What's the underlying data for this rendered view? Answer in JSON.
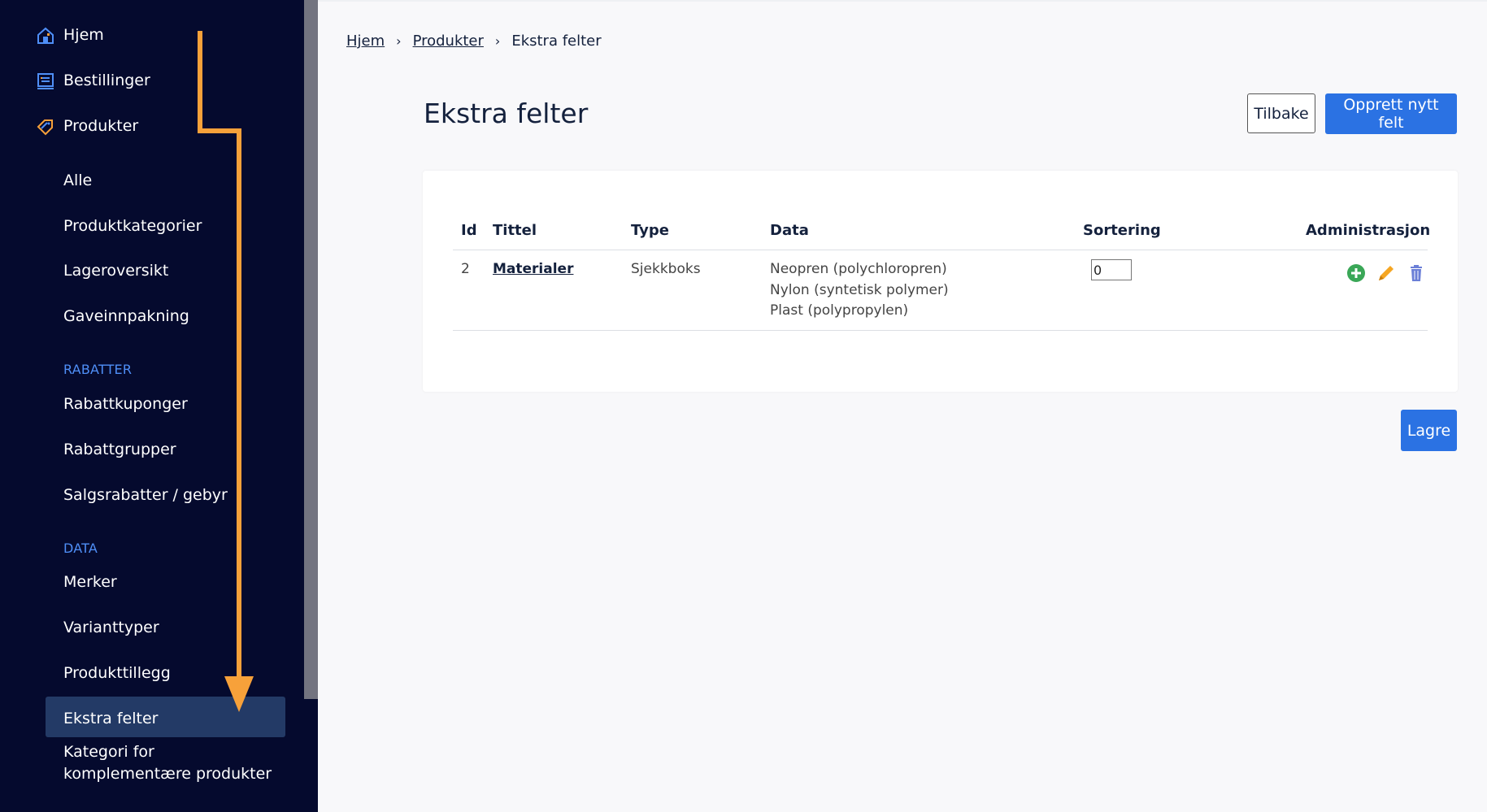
{
  "sidebar": {
    "top_items": [
      {
        "label": "Hjem",
        "icon": "house-icon"
      },
      {
        "label": "Bestillinger",
        "icon": "orders-list-icon"
      },
      {
        "label": "Produkter",
        "icon": "tag-icon"
      }
    ],
    "product_sub_items": [
      "Alle",
      "Produktkategorier",
      "Lageroversikt",
      "Gaveinnpakning"
    ],
    "sections": [
      {
        "label": "RABATTER",
        "items": [
          "Rabattkuponger",
          "Rabattgrupper",
          "Salgsrabatter / gebyr"
        ]
      },
      {
        "label": "DATA",
        "items": [
          "Merker",
          "Varianttyper",
          "Produkttillegg",
          "Ekstra felter"
        ]
      }
    ],
    "last_item": [
      "Kategori for",
      "komplementære produkter"
    ],
    "active_item": "Ekstra felter"
  },
  "breadcrumb": {
    "home": "Hjem",
    "products": "Produkter",
    "current": "Ekstra felter"
  },
  "page": {
    "title": "Ekstra felter",
    "back_button": "Tilbake",
    "create_button": "Opprett nytt felt",
    "save_button": "Lagre"
  },
  "table": {
    "headers": {
      "id": "Id",
      "title": "Tittel",
      "type": "Type",
      "data": "Data",
      "sort": "Sortering",
      "admin": "Administrasjon"
    },
    "rows": [
      {
        "id": "2",
        "title": "Materialer",
        "type": "Sjekkboks",
        "data": [
          "Neopren (polychloropren)",
          "Nylon (syntetisk polymer)",
          "Plast (polypropylen)"
        ],
        "sort": "0"
      }
    ]
  },
  "colors": {
    "sidebar_bg": "#050a2e",
    "accent": "#2b72e3",
    "arrow": "#f7a13a",
    "active_bg": "#233a66",
    "add_icon": "#3aa757",
    "edit_icon": "#f5a623",
    "delete_icon": "#6b7fd7"
  }
}
